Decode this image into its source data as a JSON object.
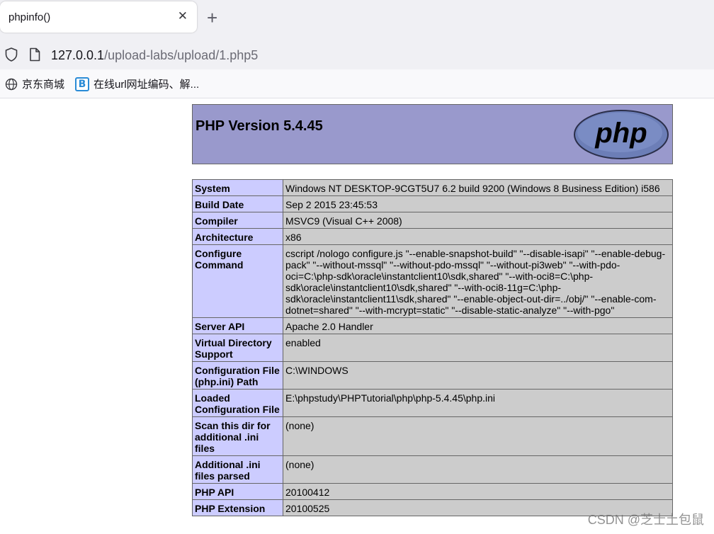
{
  "browser": {
    "tab_title": "phpinfo()",
    "close_glyph": "✕",
    "new_tab_glyph": "+",
    "url_host": "127.0.0.1",
    "url_path": "/upload-labs/upload/1.php5",
    "bookmarks": [
      {
        "label": "京东商城",
        "icon": "globe-icon"
      },
      {
        "label": "在线url网址编码、解...",
        "icon": "b-icon",
        "icon_letter": "B"
      }
    ]
  },
  "phpinfo": {
    "title": "PHP Version 5.4.45",
    "logo_text": "php",
    "header_bg": "#9999cc",
    "label_bg": "#ccccff",
    "value_bg": "#cccccc",
    "rows": [
      {
        "label": "System",
        "value": "Windows NT DESKTOP-9CGT5U7 6.2 build 9200 (Windows 8 Business Edition) i586"
      },
      {
        "label": "Build Date",
        "value": "Sep 2 2015 23:45:53"
      },
      {
        "label": "Compiler",
        "value": "MSVC9 (Visual C++ 2008)"
      },
      {
        "label": "Architecture",
        "value": "x86"
      },
      {
        "label": "Configure Command",
        "value": "cscript /nologo configure.js \"--enable-snapshot-build\" \"--disable-isapi\" \"--enable-debug-pack\" \"--without-mssql\" \"--without-pdo-mssql\" \"--without-pi3web\" \"--with-pdo-oci=C:\\php-sdk\\oracle\\instantclient10\\sdk,shared\" \"--with-oci8=C:\\php-sdk\\oracle\\instantclient10\\sdk,shared\" \"--with-oci8-11g=C:\\php-sdk\\oracle\\instantclient11\\sdk,shared\" \"--enable-object-out-dir=../obj/\" \"--enable-com-dotnet=shared\" \"--with-mcrypt=static\" \"--disable-static-analyze\" \"--with-pgo\""
      },
      {
        "label": "Server API",
        "value": "Apache 2.0 Handler"
      },
      {
        "label": "Virtual Directory Support",
        "value": "enabled"
      },
      {
        "label": "Configuration File (php.ini) Path",
        "value": "C:\\WINDOWS"
      },
      {
        "label": "Loaded Configuration File",
        "value": "E:\\phpstudy\\PHPTutorial\\php\\php-5.4.45\\php.ini"
      },
      {
        "label": "Scan this dir for additional .ini files",
        "value": "(none)"
      },
      {
        "label": "Additional .ini files parsed",
        "value": "(none)"
      },
      {
        "label": "PHP API",
        "value": "20100412"
      },
      {
        "label": "PHP Extension",
        "value": "20100525"
      }
    ]
  },
  "watermark": "CSDN @芝士土包鼠"
}
